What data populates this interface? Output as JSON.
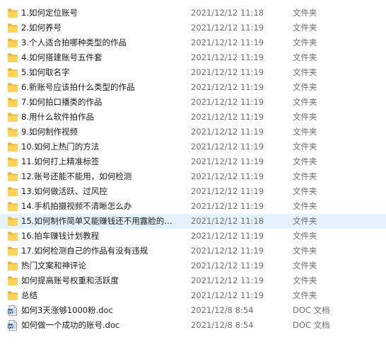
{
  "rows": [
    {
      "name": "1.如何定位账号",
      "date": "2021/12/12 11:18",
      "type": "文件夹",
      "icon": "folder-icon"
    },
    {
      "name": "2.如何养号",
      "date": "2021/12/12 11:19",
      "type": "文件夹",
      "icon": "folder-icon"
    },
    {
      "name": "3.个人适合拍哪种类型的作品",
      "date": "2021/12/12 11:19",
      "type": "文件夹",
      "icon": "folder-icon"
    },
    {
      "name": "4.如何搭建账号五件套",
      "date": "2021/12/12 11:19",
      "type": "文件夹",
      "icon": "folder-icon"
    },
    {
      "name": "5.如何取名字",
      "date": "2021/12/12 11:19",
      "type": "文件夹",
      "icon": "folder-icon"
    },
    {
      "name": "6.新账号应该拍什么类型的作品",
      "date": "2021/12/12 11:19",
      "type": "文件夹",
      "icon": "folder-icon"
    },
    {
      "name": "7.如何拍口播类的作品",
      "date": "2021/12/12 11:19",
      "type": "文件夹",
      "icon": "folder-icon"
    },
    {
      "name": "8.用什么软件拍作品",
      "date": "2021/12/12 11:19",
      "type": "文件夹",
      "icon": "folder-icon"
    },
    {
      "name": "9.如何制作视频",
      "date": "2021/12/12 11:19",
      "type": "文件夹",
      "icon": "folder-icon"
    },
    {
      "name": "10.如何上热门的方法",
      "date": "2021/12/12 11:19",
      "type": "文件夹",
      "icon": "folder-icon"
    },
    {
      "name": "11.如何打上精准标签",
      "date": "2021/12/12 11:19",
      "type": "文件夹",
      "icon": "folder-icon"
    },
    {
      "name": "12.账号还能不能用，如何检测",
      "date": "2021/12/12 11:19",
      "type": "文件夹",
      "icon": "folder-icon"
    },
    {
      "name": "13.如何做活跃、过风控",
      "date": "2021/12/12 11:19",
      "type": "文件夹",
      "icon": "folder-icon"
    },
    {
      "name": "14.手机拍摄视频不清晰怎么办",
      "date": "2021/12/12 11:19",
      "type": "文件夹",
      "icon": "folder-icon"
    },
    {
      "name": "15.如何制作简单又能赚钱还不用露脸的…",
      "date": "2021/12/12 11:18",
      "type": "文件夹",
      "icon": "folder-icon",
      "hover": true
    },
    {
      "name": "16.拍车赚钱计划教程",
      "date": "2021/12/12 11:19",
      "type": "文件夹",
      "icon": "folder-icon"
    },
    {
      "name": "17.如何检测自己的作品有没有违规",
      "date": "2021/12/12 11:19",
      "type": "文件夹",
      "icon": "folder-icon"
    },
    {
      "name": "热门文案和神评论",
      "date": "2021/12/12 11:19",
      "type": "文件夹",
      "icon": "folder-icon"
    },
    {
      "name": "如何提高账号权重和活跃度",
      "date": "2021/12/12 11:19",
      "type": "文件夹",
      "icon": "folder-icon"
    },
    {
      "name": "总结",
      "date": "2021/12/12 11:19",
      "type": "文件夹",
      "icon": "folder-icon"
    },
    {
      "name": "如何3天涨够1000粉.doc",
      "date": "2021/12/8 8:54",
      "type": "DOC 文档",
      "icon": "doc-file-icon"
    },
    {
      "name": "如何做一个成功的账号.doc",
      "date": "2021/12/8 8:54",
      "type": "DOC 文档",
      "icon": "doc-file-icon"
    }
  ],
  "colors": {
    "folder_front": "#FFD35B",
    "folder_back": "#E8B53A",
    "doc_border": "#5F7FB8",
    "doc_lines": "#2B579A",
    "hover_bg": "#E5F3FF"
  }
}
